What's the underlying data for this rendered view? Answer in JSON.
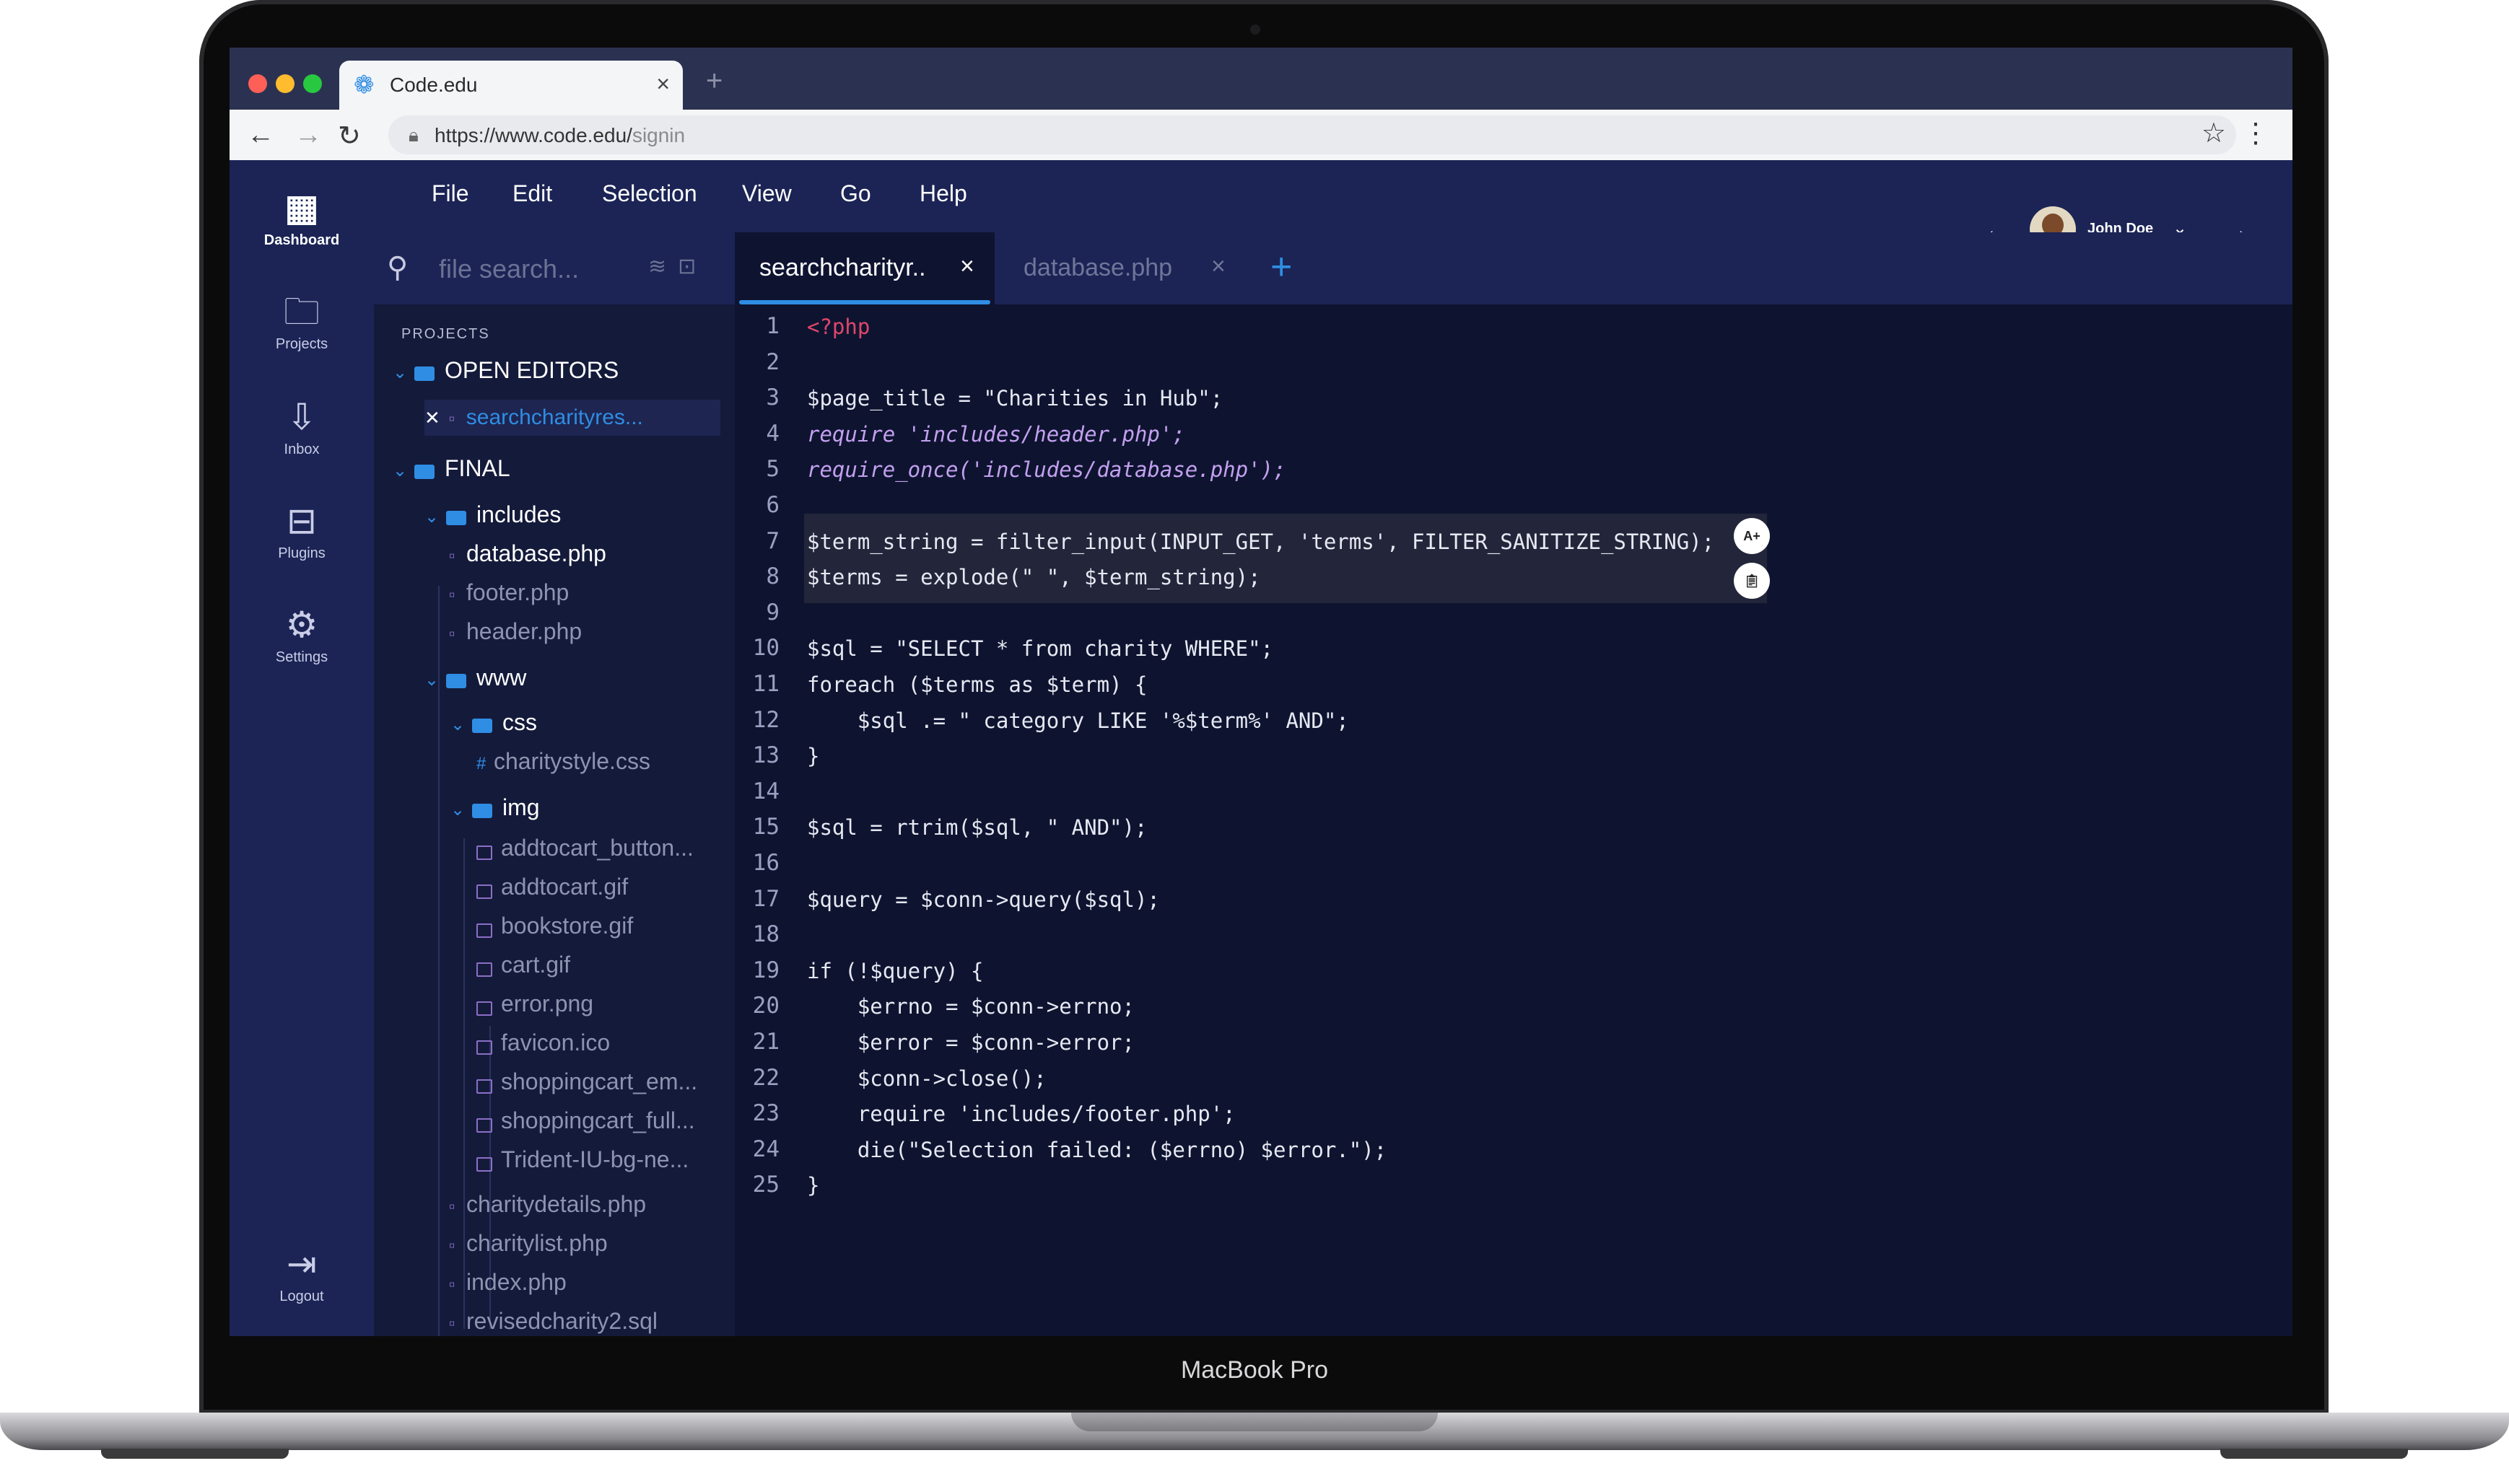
{
  "device": {
    "brand": "MacBook Pro"
  },
  "browser": {
    "tab_title": "Code.edu",
    "new_tab": "+",
    "url_main": "https://www.code.edu/",
    "url_path": "signin"
  },
  "sidebar": {
    "items": [
      {
        "label": "Dashboard",
        "icon": "dashboard-icon"
      },
      {
        "label": "Projects",
        "icon": "projects-icon"
      },
      {
        "label": "Inbox",
        "icon": "inbox-icon"
      },
      {
        "label": "Plugins",
        "icon": "plugins-icon"
      },
      {
        "label": "Settings",
        "icon": "gear-icon"
      }
    ],
    "logout": "Logout"
  },
  "menu": [
    "File",
    "Edit",
    "Selection",
    "View",
    "Go",
    "Help"
  ],
  "user": {
    "name": "John Doe"
  },
  "explorer": {
    "search_placeholder": "file search...",
    "section": "PROJECTS",
    "open_editors": "OPEN EDITORS",
    "open_file": "searchcharityres...",
    "root": "FINAL",
    "includes": "includes",
    "includes_files": [
      "database.php",
      "footer.php",
      "header.php"
    ],
    "www": "www",
    "css": "css",
    "css_files": [
      "charitystyle.css"
    ],
    "img": "img",
    "img_files": [
      "addtocart_button...",
      "addtocart.gif",
      "bookstore.gif",
      "cart.gif",
      "error.png",
      "favicon.ico",
      "shoppingcart_em...",
      "shoppingcart_full...",
      "Trident-IU-bg-ne..."
    ],
    "root_files": [
      "charitydetails.php",
      "charitylist.php",
      "index.php",
      "revisedcharity2.sql"
    ]
  },
  "editor": {
    "tabs": [
      {
        "label": "searchcharityr..",
        "close": "×"
      },
      {
        "label": "database.php",
        "close": "×"
      }
    ],
    "add_tab": "+",
    "line_numbers": [
      "1",
      "2",
      "3",
      "4",
      "5",
      "6",
      "7",
      "8",
      "9",
      "10",
      "11",
      "12",
      "13",
      "14",
      "15",
      "16",
      "17",
      "18",
      "19",
      "20",
      "21",
      "22",
      "23",
      "24",
      "25"
    ],
    "code_lines": [
      "<?php",
      "",
      "$page_title = \"Charities in Hub\";",
      "require 'includes/header.php';",
      "require_once('includes/database.php');",
      "",
      "$term_string = filter_input(INPUT_GET, 'terms', FILTER_SANITIZE_STRING);",
      "$terms = explode(\" \", $term_string);",
      "",
      "$sql = \"SELECT * from charity WHERE\";",
      "foreach ($terms as $term) {",
      "    $sql .= \" category LIKE '%$term%' AND\";",
      "}",
      "",
      "$sql = rtrim($sql, \" AND\");",
      "",
      "$query = $conn->query($sql);",
      "",
      "if (!$query) {",
      "    $errno = $conn->errno;",
      "    $error = $conn->error;",
      "    $conn->close();",
      "    require 'includes/footer.php';",
      "    die(\"Selection failed: ($errno) $error.\");",
      "}"
    ],
    "fab_label": "A+"
  },
  "colors": {
    "accent": "#2f8de4",
    "sidebar": "#1b2455",
    "editor_bg": "#0e1430"
  }
}
